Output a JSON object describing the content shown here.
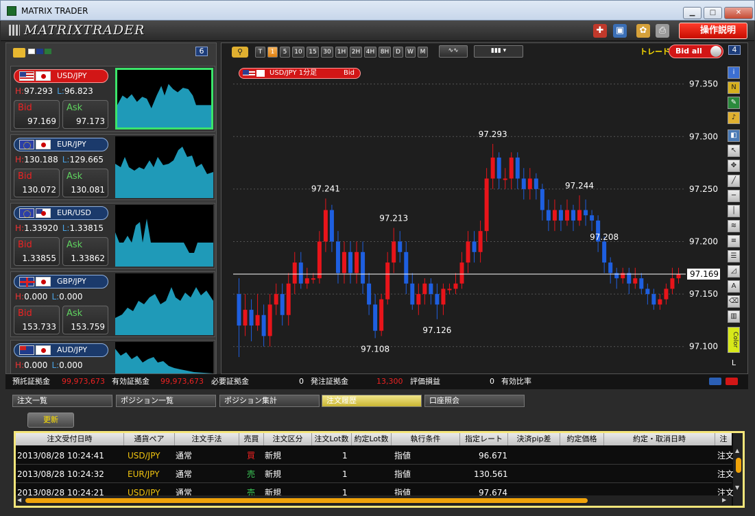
{
  "window": {
    "title": "MATRIX TRADER",
    "min": "▁",
    "max": "□",
    "close": "✕"
  },
  "toolbar": {
    "logo": "MATRIXTRADER",
    "help_label": "操作説明"
  },
  "left_panel": {
    "count": "6"
  },
  "pairs": [
    {
      "name": "USD/JPY",
      "high": "97.293",
      "low": "96.823",
      "bid_lbl": "Bid",
      "ask_lbl": "Ask",
      "bid": "97.169",
      "ask": "97.173"
    },
    {
      "name": "EUR/JPY",
      "high": "130.188",
      "low": "129.665",
      "bid_lbl": "Bid",
      "ask_lbl": "Ask",
      "bid": "130.072",
      "ask": "130.081"
    },
    {
      "name": "EUR/USD",
      "high": "1.33920",
      "low": "1.33815",
      "bid_lbl": "Bid",
      "ask_lbl": "Ask",
      "bid": "1.33855",
      "ask": "1.33862"
    },
    {
      "name": "GBP/JPY",
      "high": "0.000",
      "low": "0.000",
      "bid_lbl": "Bid",
      "ask_lbl": "Ask",
      "bid": "153.733",
      "ask": "153.759"
    },
    {
      "name": "AUD/JPY",
      "high": "0.000",
      "low": "0.000",
      "bid_lbl": "Bid",
      "ask_lbl": "Ask",
      "bid": "",
      "ask": ""
    }
  ],
  "hl_labels": {
    "h": "H:",
    "l": "L:"
  },
  "chart": {
    "timeframes": [
      "T",
      "1",
      "5",
      "10",
      "15",
      "30",
      "1H",
      "2H",
      "4H",
      "8H",
      "D",
      "W",
      "M"
    ],
    "active_timeframe": "1",
    "trade_label": "トレード",
    "bid_all": "Bid all",
    "panel_count": "4",
    "symbol_label": "USD/JPY 1分足",
    "symbol_side": "Bid",
    "y_ticks": [
      "97.350",
      "97.300",
      "97.250",
      "97.200",
      "97.150",
      "97.100"
    ],
    "current_price": "97.169",
    "annotations": [
      "97.241",
      "97.213",
      "97.293",
      "97.244",
      "97.208",
      "97.126",
      "97.108"
    ],
    "right_tools_label": "L"
  },
  "chart_data": {
    "type": "candlestick",
    "ylim": [
      97.075,
      97.37
    ],
    "y_ticks": [
      97.35,
      97.3,
      97.25,
      97.2,
      97.15,
      97.1
    ],
    "current": 97.169,
    "candles": [
      [
        97.15,
        97.12,
        97.165,
        97.09
      ],
      [
        97.12,
        97.135,
        97.15,
        97.11
      ],
      [
        97.135,
        97.12,
        97.145,
        97.105
      ],
      [
        97.12,
        97.13,
        97.15,
        97.115
      ],
      [
        97.13,
        97.11,
        97.14,
        97.1
      ],
      [
        97.11,
        97.14,
        97.15,
        97.1
      ],
      [
        97.14,
        97.15,
        97.16,
        97.13
      ],
      [
        97.15,
        97.13,
        97.16,
        97.12
      ],
      [
        97.13,
        97.16,
        97.17,
        97.12
      ],
      [
        97.16,
        97.18,
        97.19,
        97.15
      ],
      [
        97.18,
        97.16,
        97.19,
        97.155
      ],
      [
        97.16,
        97.165,
        97.175,
        97.155
      ],
      [
        97.165,
        97.165,
        97.17,
        97.16
      ],
      [
        97.165,
        97.2,
        97.21,
        97.16
      ],
      [
        97.2,
        97.23,
        97.241,
        97.19
      ],
      [
        97.23,
        97.2,
        97.235,
        97.19
      ],
      [
        97.2,
        97.17,
        97.21,
        97.16
      ],
      [
        97.17,
        97.19,
        97.2,
        97.16
      ],
      [
        97.19,
        97.17,
        97.2,
        97.16
      ],
      [
        97.17,
        97.19,
        97.2,
        97.16
      ],
      [
        97.19,
        97.16,
        97.2,
        97.15
      ],
      [
        97.16,
        97.14,
        97.17,
        97.13
      ],
      [
        97.14,
        97.115,
        97.15,
        97.108
      ],
      [
        97.115,
        97.145,
        97.15,
        97.11
      ],
      [
        97.145,
        97.18,
        97.19,
        97.14
      ],
      [
        97.18,
        97.2,
        97.213,
        97.17
      ],
      [
        97.2,
        97.19,
        97.21,
        97.18
      ],
      [
        97.19,
        97.16,
        97.2,
        97.15
      ],
      [
        97.16,
        97.14,
        97.17,
        97.135
      ],
      [
        97.14,
        97.15,
        97.16,
        97.13
      ],
      [
        97.15,
        97.16,
        97.165,
        97.14
      ],
      [
        97.16,
        97.15,
        97.165,
        97.14
      ],
      [
        97.15,
        97.14,
        97.16,
        97.126
      ],
      [
        97.14,
        97.155,
        97.16,
        97.13
      ],
      [
        97.155,
        97.155,
        97.16,
        97.15
      ],
      [
        97.155,
        97.16,
        97.17,
        97.15
      ],
      [
        97.16,
        97.18,
        97.19,
        97.155
      ],
      [
        97.18,
        97.2,
        97.21,
        97.17
      ],
      [
        97.2,
        97.19,
        97.21,
        97.18
      ],
      [
        97.19,
        97.21,
        97.22,
        97.18
      ],
      [
        97.21,
        97.26,
        97.27,
        97.2
      ],
      [
        97.26,
        97.28,
        97.293,
        97.25
      ],
      [
        97.28,
        97.26,
        97.285,
        97.25
      ],
      [
        97.26,
        97.26,
        97.27,
        97.25
      ],
      [
        97.26,
        97.28,
        97.285,
        97.25
      ],
      [
        97.28,
        97.26,
        97.285,
        97.25
      ],
      [
        97.26,
        97.25,
        97.27,
        97.24
      ],
      [
        97.25,
        97.26,
        97.27,
        97.24
      ],
      [
        97.26,
        97.25,
        97.265,
        97.24
      ],
      [
        97.25,
        97.23,
        97.255,
        97.22
      ],
      [
        97.23,
        97.22,
        97.24,
        97.21
      ],
      [
        97.22,
        97.23,
        97.24,
        97.21
      ],
      [
        97.23,
        97.22,
        97.235,
        97.21
      ],
      [
        97.22,
        97.23,
        97.24,
        97.215
      ],
      [
        97.23,
        97.22,
        97.235,
        97.21
      ],
      [
        97.22,
        97.23,
        97.244,
        97.215
      ],
      [
        97.23,
        97.225,
        97.24,
        97.215
      ],
      [
        97.225,
        97.22,
        97.23,
        97.21
      ],
      [
        97.22,
        97.2,
        97.225,
        97.19
      ],
      [
        97.2,
        97.18,
        97.205,
        97.17
      ],
      [
        97.18,
        97.17,
        97.185,
        97.16
      ],
      [
        97.17,
        97.165,
        97.175,
        97.155
      ],
      [
        97.165,
        97.17,
        97.175,
        97.16
      ],
      [
        97.17,
        97.16,
        97.175,
        97.15
      ],
      [
        97.16,
        97.165,
        97.175,
        97.155
      ],
      [
        97.165,
        97.155,
        97.17,
        97.15
      ],
      [
        97.155,
        97.15,
        97.16,
        97.14
      ],
      [
        97.15,
        97.14,
        97.155,
        97.135
      ],
      [
        97.14,
        97.145,
        97.15,
        97.135
      ],
      [
        97.145,
        97.155,
        97.16,
        97.14
      ],
      [
        97.155,
        97.165,
        97.175,
        97.15
      ],
      [
        97.165,
        97.169,
        97.175,
        97.16
      ]
    ]
  },
  "summary": {
    "items": [
      {
        "label": "預託証拠金",
        "value": "99,973,673"
      },
      {
        "label": "有効証拠金",
        "value": "99,973,673"
      },
      {
        "label": "必要証拠金",
        "value": "0"
      },
      {
        "label": "発注証拠金",
        "value": "13,300"
      },
      {
        "label": "評価損益",
        "value": "0"
      },
      {
        "label": "有効比率",
        "value": ""
      }
    ]
  },
  "tabs": [
    "注文一覧",
    "ポジション一覧",
    "ポジション集計",
    "注文履歴",
    "口座照会"
  ],
  "active_tab": "注文履歴",
  "refresh_label": "更新",
  "table": {
    "columns": [
      "注文受付日時",
      "通貨ペア",
      "注文手法",
      "売買",
      "注文区分",
      "注文Lot数",
      "約定Lot数",
      "執行条件",
      "指定レート",
      "決済pip差",
      "約定価格",
      "約定・取消日時",
      "注"
    ],
    "rows": [
      {
        "time": "2013/08/28  10:24:41",
        "pair": "USD/JPY",
        "method": "通常",
        "side": "買",
        "kind": "新規",
        "lots": "1",
        "cond": "指値",
        "rate": "96.671",
        "tail": "注文"
      },
      {
        "time": "2013/08/28  10:24:32",
        "pair": "EUR/JPY",
        "method": "通常",
        "side": "売",
        "kind": "新規",
        "lots": "1",
        "cond": "指値",
        "rate": "130.561",
        "tail": "注文"
      },
      {
        "time": "2013/08/28  10:24:21",
        "pair": "USD/JPY",
        "method": "通常",
        "side": "売",
        "kind": "新規",
        "lots": "1",
        "cond": "指値",
        "rate": "97.674",
        "tail": "注文"
      }
    ]
  },
  "colors": {
    "up": "#e8141a",
    "down": "#1e5fe0",
    "accent": "#d21616",
    "highlight": "#f5e67a"
  }
}
